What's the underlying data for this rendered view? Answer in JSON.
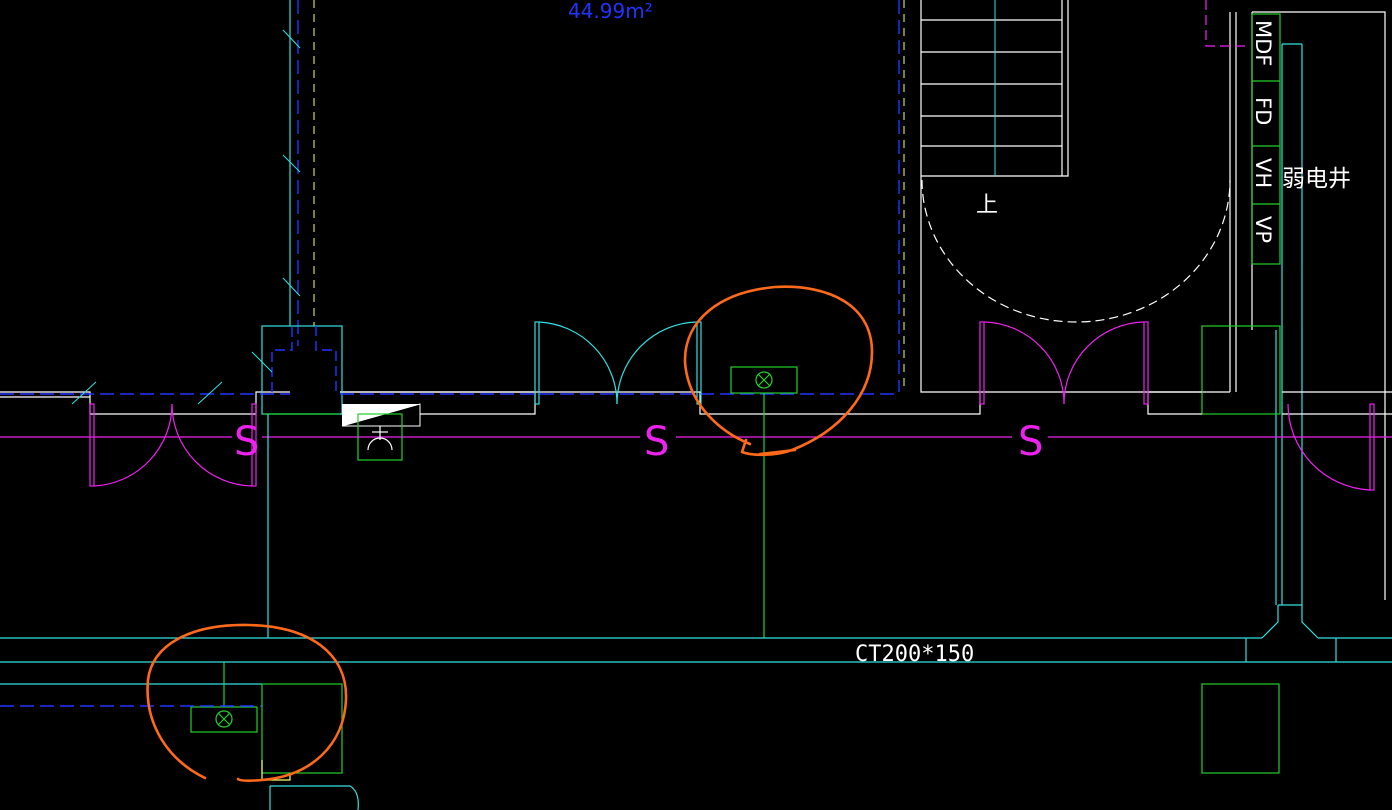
{
  "drawing": {
    "area_label": "44.99m²",
    "riser_labels": [
      "MDF",
      "FD",
      "VH",
      "VP"
    ],
    "shaft_label": "弱电井",
    "stair_direction_label": "上",
    "door_tags": [
      "S",
      "S",
      "S"
    ],
    "cable_tray_label": "CT200*150"
  },
  "colors": {
    "background": "#000000",
    "wall": "#ffffff",
    "cyan": "#33e0e0",
    "blue": "#2233ff",
    "green": "#22d02a",
    "magenta": "#ee22ee",
    "yellow": "#ffff66",
    "markup": "#ff6a1a"
  },
  "icons": {
    "light_fixture": "cross-circle-light-icon",
    "socket": "socket-outlet-icon"
  }
}
